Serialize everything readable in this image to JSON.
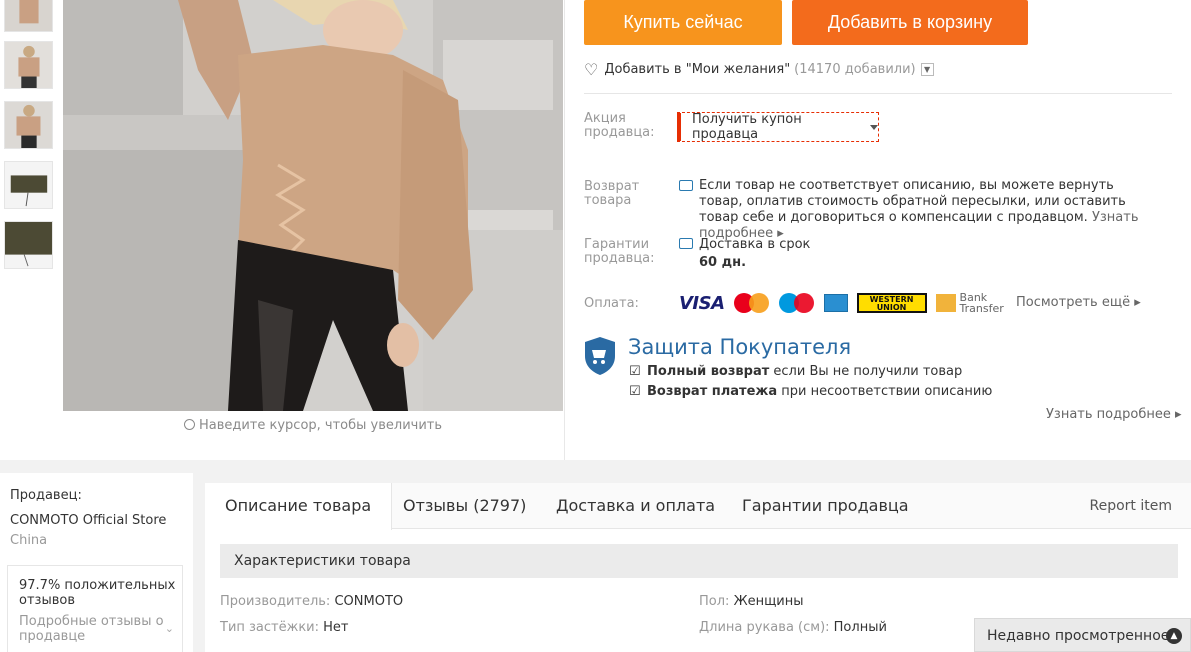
{
  "buy_now": "Купить сейчас",
  "add_to_cart": "Добавить в корзину",
  "wishlist": {
    "label": "Добавить в \"Мои желания\"",
    "count": "(14170 добавили)"
  },
  "seller_promo": {
    "label": "Акция продавца:",
    "coupon": "Получить купон продавца"
  },
  "returns": {
    "label": "Возврат товара",
    "text": "Если товар не соответствует описанию, вы можете вернуть товар, оплатив стоимость обратной пересылки, или оставить товар себе и договориться о компенсации с продавцом.",
    "more": "Узнать подробнее"
  },
  "guarantee": {
    "label": "Гарантии продавца:",
    "text": "Доставка в срок",
    "days": "60 дн."
  },
  "payment": {
    "label": "Оплата:",
    "visa": "VISA",
    "western_union": "WESTERN UNION",
    "bank_transfer_1": "Bank",
    "bank_transfer_2": "Transfer",
    "more": "Посмотреть ещё"
  },
  "protection": {
    "title": "Защита Покупателя",
    "line1_bold": "Полный возврат",
    "line1_rest": "если Вы не получили товар",
    "line2_bold": "Возврат платежа",
    "line2_rest": "при несоответствии описанию",
    "more": "Узнать подробнее"
  },
  "zoom_hint": "Наведите курсор, чтобы увеличить",
  "seller": {
    "label": "Продавец:",
    "name": "CONMOTO Official Store",
    "country": "China",
    "positive": "97.7%  положительных отзывов",
    "details": "Подробные отзывы о продавце"
  },
  "tabs": [
    "Описание товара",
    "Отзывы (2797)",
    "Доставка и оплата",
    "Гарантии продавца"
  ],
  "report": "Report item",
  "specs_title": "Характеристики товара",
  "specs": [
    {
      "k": "Производитель:",
      "v": "CONMOTO"
    },
    {
      "k": "Пол:",
      "v": "Женщины"
    },
    {
      "k": "Тип застёжки:",
      "v": "Нет"
    },
    {
      "k": "Длина рукава (см):",
      "v": "Полный"
    }
  ],
  "recently_viewed": "Недавно просмотренное",
  "colors": {
    "buy": "#f7941d",
    "cart": "#f36b1c",
    "protection": "#2a6aa3",
    "coupon_border": "#e62e04"
  }
}
